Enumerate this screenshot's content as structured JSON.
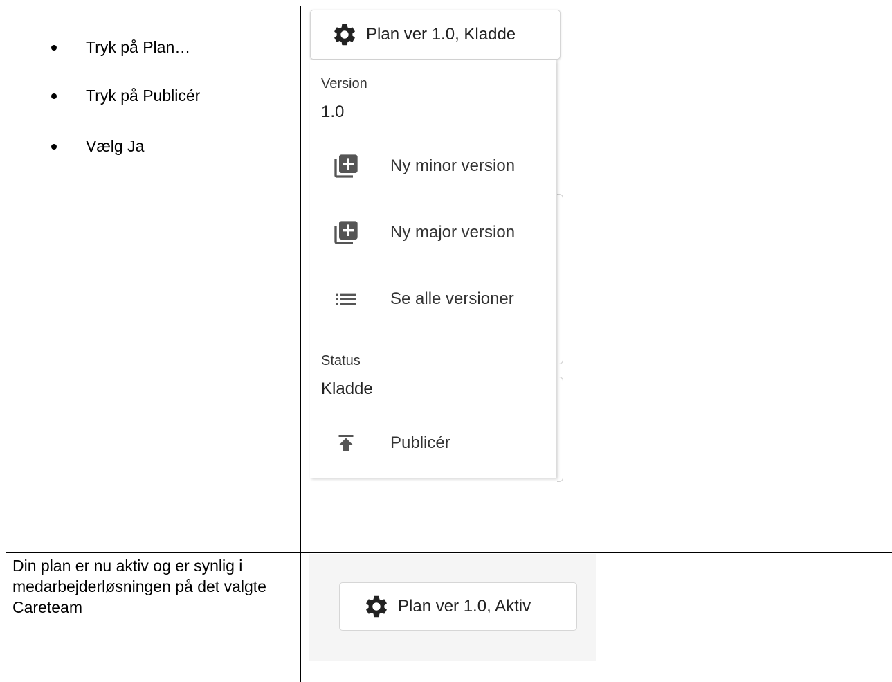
{
  "instructions": {
    "steps": [
      "Tryk på Plan…",
      "Tryk på Publicér",
      "Vælg Ja"
    ],
    "result": "Din plan er nu aktiv og er synlig i medarbejderløsningen på det valgte Careteam"
  },
  "screenshot_menu": {
    "plan_button_label": "Plan ver 1.0, Kladde",
    "version_section": {
      "label": "Version",
      "value": "1.0",
      "items": [
        {
          "label": "Ny minor version",
          "icon": "library-add-icon"
        },
        {
          "label": "Ny major version",
          "icon": "library-add-icon"
        },
        {
          "label": "Se alle versioner",
          "icon": "list-icon"
        }
      ]
    },
    "status_section": {
      "label": "Status",
      "value": "Kladde",
      "items": [
        {
          "label": "Publicér",
          "icon": "publish-icon"
        }
      ]
    }
  },
  "screenshot_result": {
    "plan_button_label": "Plan ver 1.0, Aktiv"
  },
  "colors": {
    "icon": "#222222",
    "menu_icon": "#555555",
    "border": "#d6d6d6",
    "panel_background": "#f5f5f5"
  }
}
